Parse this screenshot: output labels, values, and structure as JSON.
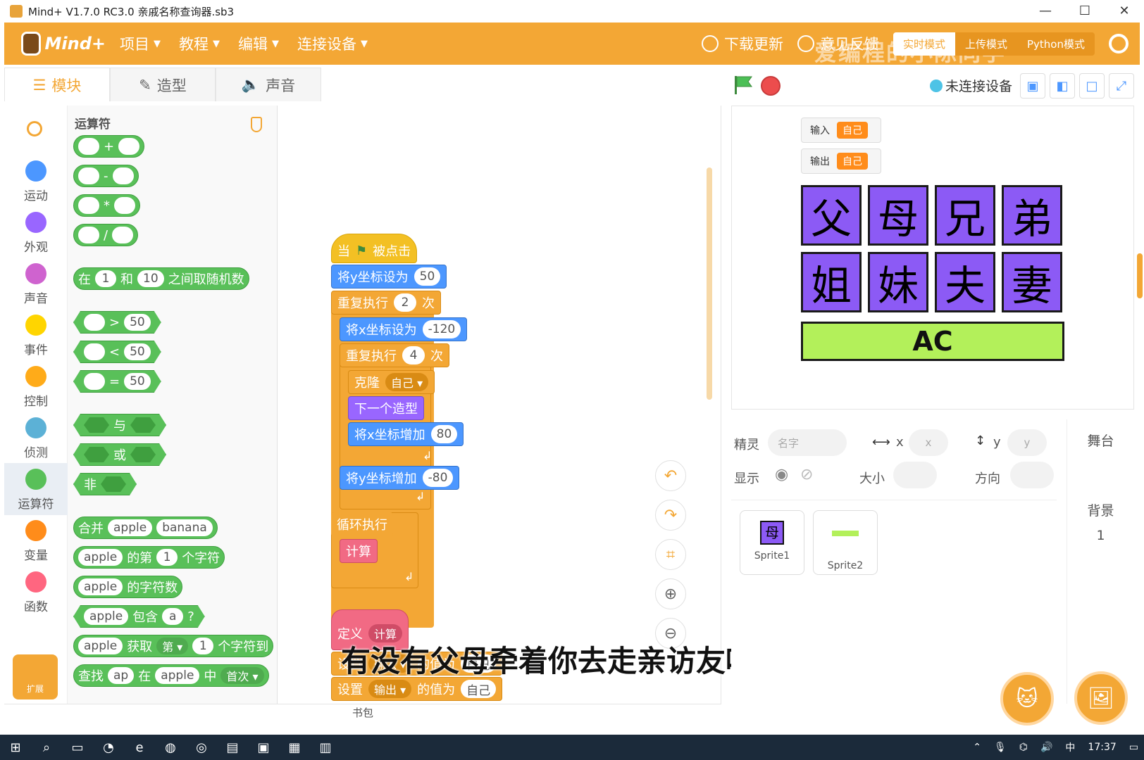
{
  "window": {
    "title": "Mind+ V1.7.0 RC3.0   亲戚名称查询器.sb3",
    "controls": [
      "—",
      "☐",
      "✕"
    ]
  },
  "menubar": {
    "logo": "Mind+",
    "menus": [
      "项目",
      "教程",
      "编辑",
      "连接设备"
    ],
    "update": "下载更新",
    "feedback": "意见反馈",
    "mode_realtime": "实时模式",
    "mode_upload": "上传模式",
    "mode_python": "Python模式",
    "watermark": "爱编程的小陈同学"
  },
  "tabs": [
    "模块",
    "造型",
    "声音"
  ],
  "connection": "未连接设备",
  "categories": [
    {
      "label": "运动",
      "color": "#4c97ff"
    },
    {
      "label": "外观",
      "color": "#9966ff"
    },
    {
      "label": "声音",
      "color": "#cf63cf"
    },
    {
      "label": "事件",
      "color": "#ffd500"
    },
    {
      "label": "控制",
      "color": "#ffab19"
    },
    {
      "label": "侦测",
      "color": "#5cb1d6"
    },
    {
      "label": "运算符",
      "color": "#59c059"
    },
    {
      "label": "变量",
      "color": "#ff8c1a"
    },
    {
      "label": "函数",
      "color": "#ff6680"
    }
  ],
  "extension_label": "扩展",
  "palette": {
    "title": "运算符",
    "ops": [
      "+",
      "-",
      "*",
      "/"
    ],
    "random": {
      "a": "在",
      "v1": "1",
      "b": "和",
      "v2": "10",
      "c": "之间取随机数"
    },
    "gt": {
      "op": ">",
      "v": "50"
    },
    "lt": {
      "op": "<",
      "v": "50"
    },
    "eq": {
      "op": "=",
      "v": "50"
    },
    "and": "与",
    "or": "或",
    "not": "非",
    "join": {
      "a": "合并",
      "v1": "apple",
      "v2": "banana"
    },
    "letter": {
      "v1": "apple",
      "a": "的第",
      "v2": "1",
      "b": "个字符"
    },
    "length": {
      "v1": "apple",
      "a": "的字符数"
    },
    "contains": {
      "v1": "apple",
      "a": "包含",
      "v2": "a",
      "b": "?"
    },
    "substr": {
      "v1": "apple",
      "a": "获取",
      "dd": "第 ▾",
      "v2": "1",
      "b": "个字符到"
    },
    "find": {
      "a": "查找",
      "v1": "ap",
      "b": "在",
      "v2": "apple",
      "c": "中",
      "dd": "首次 ▾"
    }
  },
  "script": {
    "when_flag": {
      "a": "当",
      "b": "被点击"
    },
    "set_y": {
      "label": "将y坐标设为",
      "v": "50"
    },
    "repeat_outer": {
      "a": "重复执行",
      "v": "2",
      "b": "次"
    },
    "set_x": {
      "label": "将x坐标设为",
      "v": "-120"
    },
    "repeat_inner": {
      "a": "重复执行",
      "v": "4",
      "b": "次"
    },
    "clone": {
      "label": "克隆",
      "dd": "自己 ▾"
    },
    "next_costume": "下一个造型",
    "change_x": {
      "label": "将x坐标增加",
      "v": "80"
    },
    "change_y": {
      "label": "将y坐标增加",
      "v": "-80"
    },
    "forever": "循环执行",
    "calc": "计算",
    "define": {
      "a": "定义",
      "b": "计算"
    },
    "set1": {
      "a": "设置",
      "dd": "输入 ▾",
      "b": "的值为",
      "v": "自己"
    },
    "set2": {
      "a": "设置",
      "dd": "输出 ▾",
      "b": "的值为",
      "v": "自己"
    }
  },
  "subtitle": "有没有父母牵着你去走亲访友呢",
  "bookbag": "书包",
  "stage": {
    "var_in": {
      "name": "输入",
      "value": "自己"
    },
    "var_out": {
      "name": "输出",
      "value": "自己"
    },
    "tiles": [
      "父",
      "母",
      "兄",
      "弟",
      "姐",
      "妹",
      "夫",
      "妻"
    ],
    "result": "AC"
  },
  "sprite_info": {
    "sprite_label": "精灵",
    "name_placeholder": "名字",
    "x_label": "x",
    "x_placeholder": "x",
    "y_label": "y",
    "y_placeholder": "y",
    "show_label": "显示",
    "size_label": "大小",
    "direction_label": "方向"
  },
  "sprites": [
    {
      "name": "Sprite1",
      "glyph": "母"
    },
    {
      "name": "Sprite2",
      "glyph": ""
    }
  ],
  "stage_pane": {
    "title": "舞台",
    "backdrop_label": "背景",
    "backdrop_count": "1"
  },
  "taskbar": {
    "time": "17:37",
    "ime": "中"
  }
}
